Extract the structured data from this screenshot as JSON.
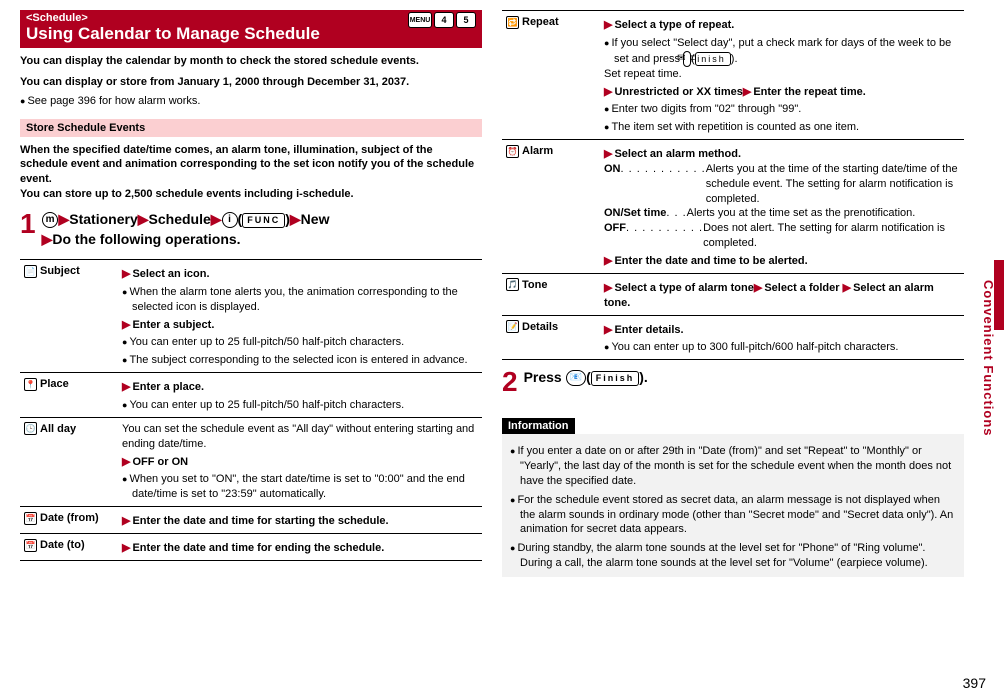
{
  "sideTab": "Convenient Functions",
  "pageNumber": "397",
  "header": {
    "tag": "<Schedule>",
    "title": "Using Calendar to Manage Schedule",
    "menu": "MENU",
    "d1": "4",
    "d2": "5"
  },
  "intro1": "You can display the calendar by month to check the stored schedule events.",
  "intro2": "You can display or store from January 1, 2000 through December 31, 2037.",
  "introBullet": "See page 396 for how alarm works.",
  "section1": {
    "title": "Store Schedule Events",
    "body": "When the specified date/time comes, an alarm tone, illumination, subject of the schedule event and animation corresponding to the set icon notify you of the schedule event.\nYou can store up to 2,500 schedule events including i-schedule."
  },
  "step1": {
    "num": "1",
    "menu": "m",
    "t1": "Stationery",
    "t2": "Schedule",
    "alpha": "i",
    "func": "FUNC",
    "t3": "New",
    "t4": "Do the following operations."
  },
  "tableLeft": [
    {
      "icon": "📄",
      "label": "Subject",
      "rows": [
        {
          "tri": true,
          "bold": true,
          "text": "Select an icon."
        },
        {
          "bul": true,
          "text": "When the alarm tone alerts you, the animation corresponding to the selected icon is displayed."
        },
        {
          "tri": true,
          "bold": true,
          "text": "Enter a subject."
        },
        {
          "bul": true,
          "text": "You can enter up to 25 full-pitch/50 half-pitch characters."
        },
        {
          "bul": true,
          "text": "The subject corresponding to the selected icon is entered in advance."
        }
      ]
    },
    {
      "icon": "📍",
      "label": "Place",
      "rows": [
        {
          "tri": true,
          "bold": true,
          "text": "Enter a place."
        },
        {
          "bul": true,
          "text": "You can enter up to 25 full-pitch/50 half-pitch characters."
        }
      ]
    },
    {
      "icon": "🕒",
      "label": "All day",
      "rows": [
        {
          "plain": true,
          "text": "You can set the schedule event as \"All day\" without entering starting and ending date/time."
        },
        {
          "tri": true,
          "bold": true,
          "text": "OFF or ON"
        },
        {
          "bul": true,
          "text": "When you set to \"ON\", the start date/time is set to \"0:00\" and the end date/time is set to \"23:59\" automatically."
        }
      ]
    },
    {
      "icon": "📅",
      "label": "Date (from)",
      "rows": [
        {
          "tri": true,
          "bold": true,
          "text": "Enter the date and time for starting the schedule."
        }
      ]
    },
    {
      "icon": "📅",
      "label": "Date (to)",
      "rows": [
        {
          "tri": true,
          "bold": true,
          "text": "Enter the date and time for ending the schedule."
        }
      ]
    }
  ],
  "tableRight": [
    {
      "icon": "🔁",
      "label": "Repeat",
      "rows": [
        {
          "tri": true,
          "bold": true,
          "text": "Select a type of repeat."
        },
        {
          "bul": true,
          "text": "If you select \"Select day\", put a check mark for days of the week to be set and press 📧(Finish)."
        },
        {
          "plain": true,
          "text": "Set repeat time."
        },
        {
          "tri": true,
          "bold": true,
          "text": "Unrestricted or XX times▶Enter the repeat time."
        },
        {
          "bul": true,
          "text": "Enter two digits from \"02\" through \"99\"."
        },
        {
          "bul": true,
          "text": "The item set with repetition is counted as one item."
        }
      ]
    },
    {
      "icon": "⏰",
      "label": "Alarm",
      "rows": [
        {
          "tri": true,
          "bold": true,
          "text": "Select an alarm method."
        },
        {
          "def": true,
          "term": "ON",
          "dots": ". . . . . . . . . . .",
          "text": "Alerts you at the time of the starting date/time of the schedule event. The setting for alarm notification is completed."
        },
        {
          "def": true,
          "term": "ON/Set time",
          "dots": ". . .",
          "text": "Alerts you at the time set as the prenotification."
        },
        {
          "def": true,
          "term": "OFF",
          "dots": ". . . . . . . . . .",
          "text": "Does not alert. The setting for alarm notification is completed."
        },
        {
          "tri": true,
          "bold": true,
          "text": "Enter the date and time to be alerted."
        }
      ]
    },
    {
      "icon": "🎵",
      "label": "Tone",
      "rows": [
        {
          "tri": true,
          "bold": true,
          "text": "Select a type of alarm tone▶Select a folder ▶Select an alarm tone."
        }
      ]
    },
    {
      "icon": "📝",
      "label": "Details",
      "rows": [
        {
          "tri": true,
          "bold": true,
          "text": "Enter details."
        },
        {
          "bul": true,
          "text": "You can enter up to 300 full-pitch/600 half-pitch characters."
        }
      ]
    }
  ],
  "step2": {
    "num": "2",
    "pre": "Press ",
    "btn": "📧",
    "func": "Finish",
    "post": "."
  },
  "info": {
    "title": "Information",
    "items": [
      "If you enter a date on or after 29th in \"Date (from)\" and set \"Repeat\" to \"Monthly\" or \"Yearly\", the last day of the month is set for the schedule event when the month does not have the specified date.",
      "For the schedule event stored as secret data, an alarm message is not displayed when the alarm sounds in ordinary mode (other than \"Secret mode\" and \"Secret data only\"). An animation for secret data appears.",
      "During standby, the alarm tone sounds at the level set for \"Phone\" of \"Ring volume\". During a call, the alarm tone sounds at the level set for \"Volume\" (earpiece volume)."
    ]
  }
}
